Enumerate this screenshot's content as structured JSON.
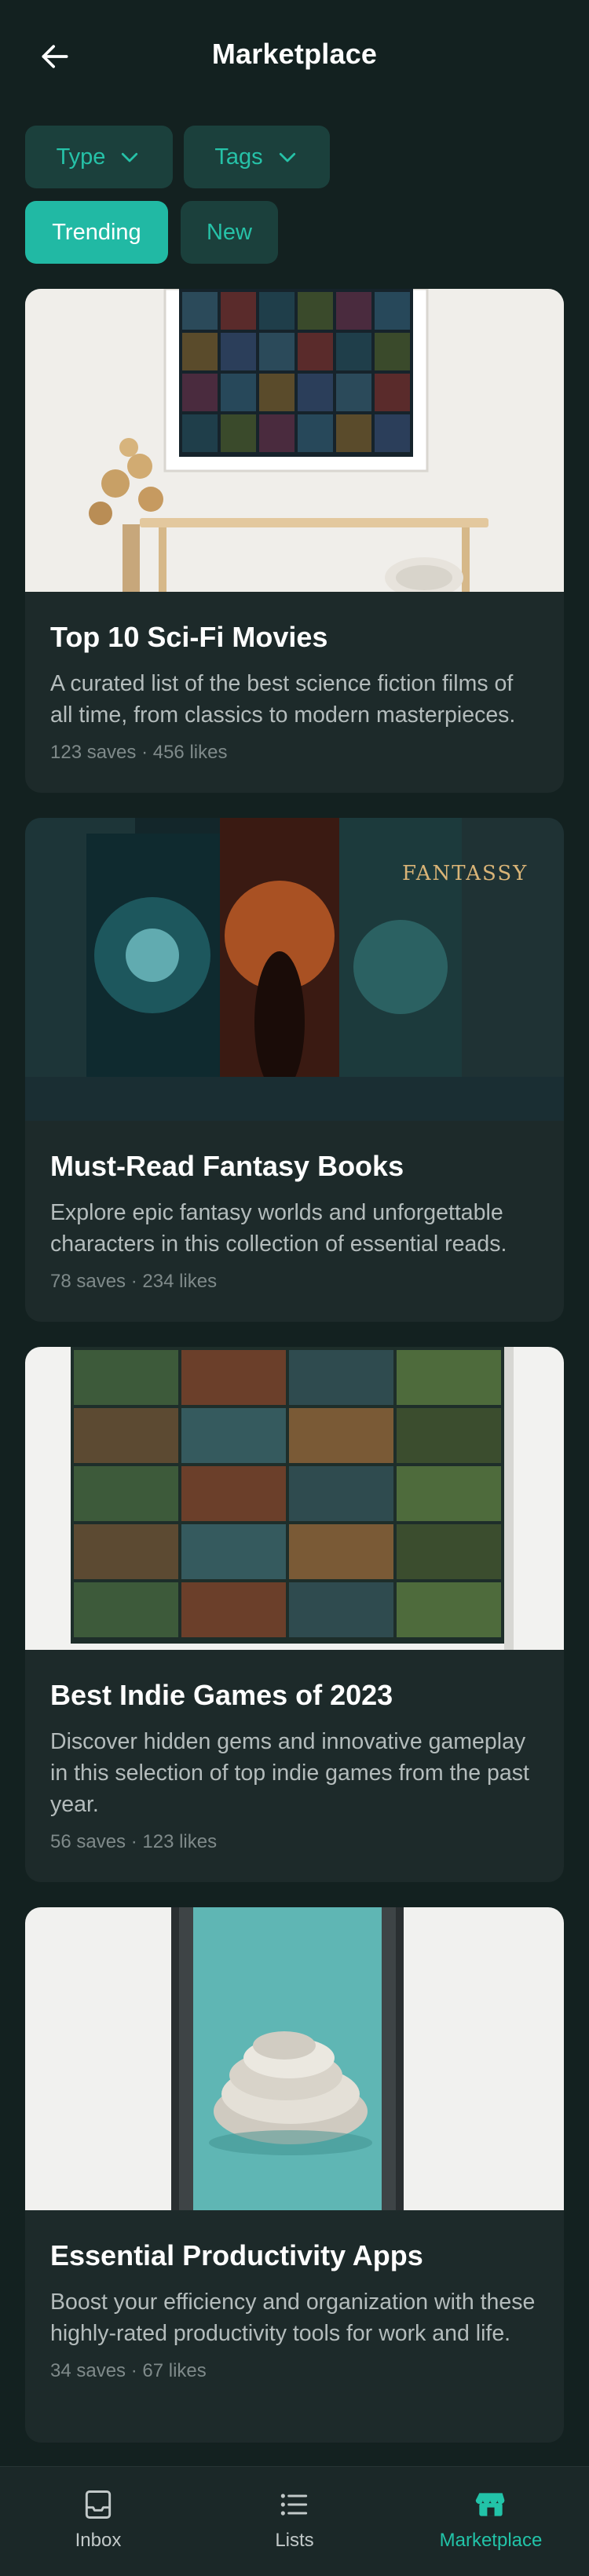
{
  "header": {
    "title": "Marketplace",
    "back_icon": "arrow-left-icon"
  },
  "filters": {
    "type_label": "Type",
    "tags_label": "Tags",
    "trending_label": "Trending",
    "new_label": "New",
    "selected": "Trending"
  },
  "cards": [
    {
      "title": "Top 10 Sci-Fi Movies",
      "description": "A curated list of the best science fiction films of all time, from classics to modern masterpieces.",
      "meta": "123 saves · 456 likes"
    },
    {
      "title": "Must-Read Fantasy Books",
      "description": "Explore epic fantasy worlds and unforgettable characters in this collection of essential reads.",
      "meta": "78 saves · 234 likes"
    },
    {
      "title": "Best Indie Games of 2023",
      "description": "Discover hidden gems and innovative gameplay in this selection of top indie games from the past year.",
      "meta": "56 saves · 123 likes"
    },
    {
      "title": "Essential Productivity Apps",
      "description": "Boost your efficiency and organization with these highly-rated productivity tools for work and life.",
      "meta": "34 saves · 67 likes"
    }
  ],
  "bottom_nav": {
    "items": [
      {
        "label": "Inbox",
        "icon": "inbox-tray-icon"
      },
      {
        "label": "Lists",
        "icon": "list-icon"
      },
      {
        "label": "Marketplace",
        "icon": "storefront-icon"
      }
    ],
    "active": "Marketplace"
  },
  "colors": {
    "background": "#132120",
    "card": "#1d2a2a",
    "accent": "#21b9a4",
    "chip": "#1b403c"
  }
}
